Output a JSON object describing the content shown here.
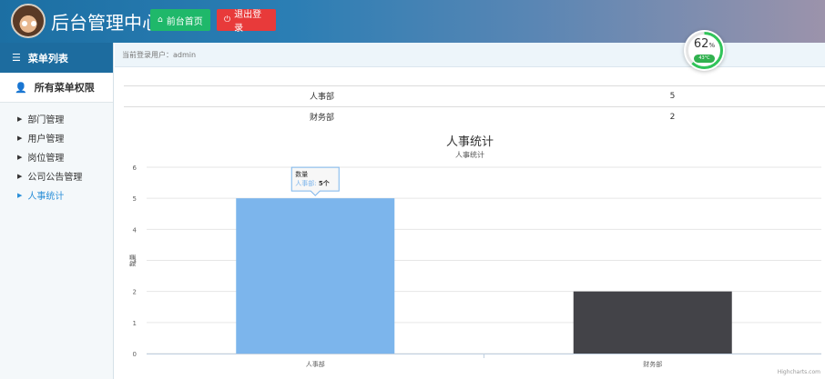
{
  "header": {
    "title": "后台管理中心",
    "home_button": "前台首页",
    "logout_button": "退出登录",
    "home_icon": "home-icon",
    "logout_icon": "power-icon",
    "colors": {
      "home": "#1fb86a",
      "logout": "#e83a3a"
    }
  },
  "sidebar": {
    "title": "菜单列表",
    "permission_title": "所有菜单权限",
    "items": [
      {
        "label": "部门管理"
      },
      {
        "label": "用户管理"
      },
      {
        "label": "岗位管理"
      },
      {
        "label": "公司公告管理"
      },
      {
        "label": "人事统计",
        "active": true
      }
    ]
  },
  "userbar": {
    "text": "当前登录用户：admin"
  },
  "gauge": {
    "percent": 62,
    "percent_unit": "%",
    "temperature": "43°C"
  },
  "table": {
    "rows": [
      {
        "name": "人事部",
        "count": "5"
      },
      {
        "name": "财务部",
        "count": "2"
      }
    ]
  },
  "chart_data": {
    "type": "bar",
    "title": "人事统计",
    "subtitle": "人事统计",
    "ylabel": "数量",
    "categories": [
      "人事部",
      "财务部"
    ],
    "series": [
      {
        "name": "数量",
        "values": [
          5,
          2
        ]
      }
    ],
    "bar_colors": [
      "#7cb5ec",
      "#434348"
    ],
    "ylim": [
      0,
      6
    ],
    "yticks": [
      0,
      1,
      2,
      3,
      4,
      5,
      6
    ],
    "grid": true,
    "tooltip": {
      "title": "数量",
      "category": "人事部",
      "value": "5个"
    },
    "credits": "Highcharts.com"
  }
}
